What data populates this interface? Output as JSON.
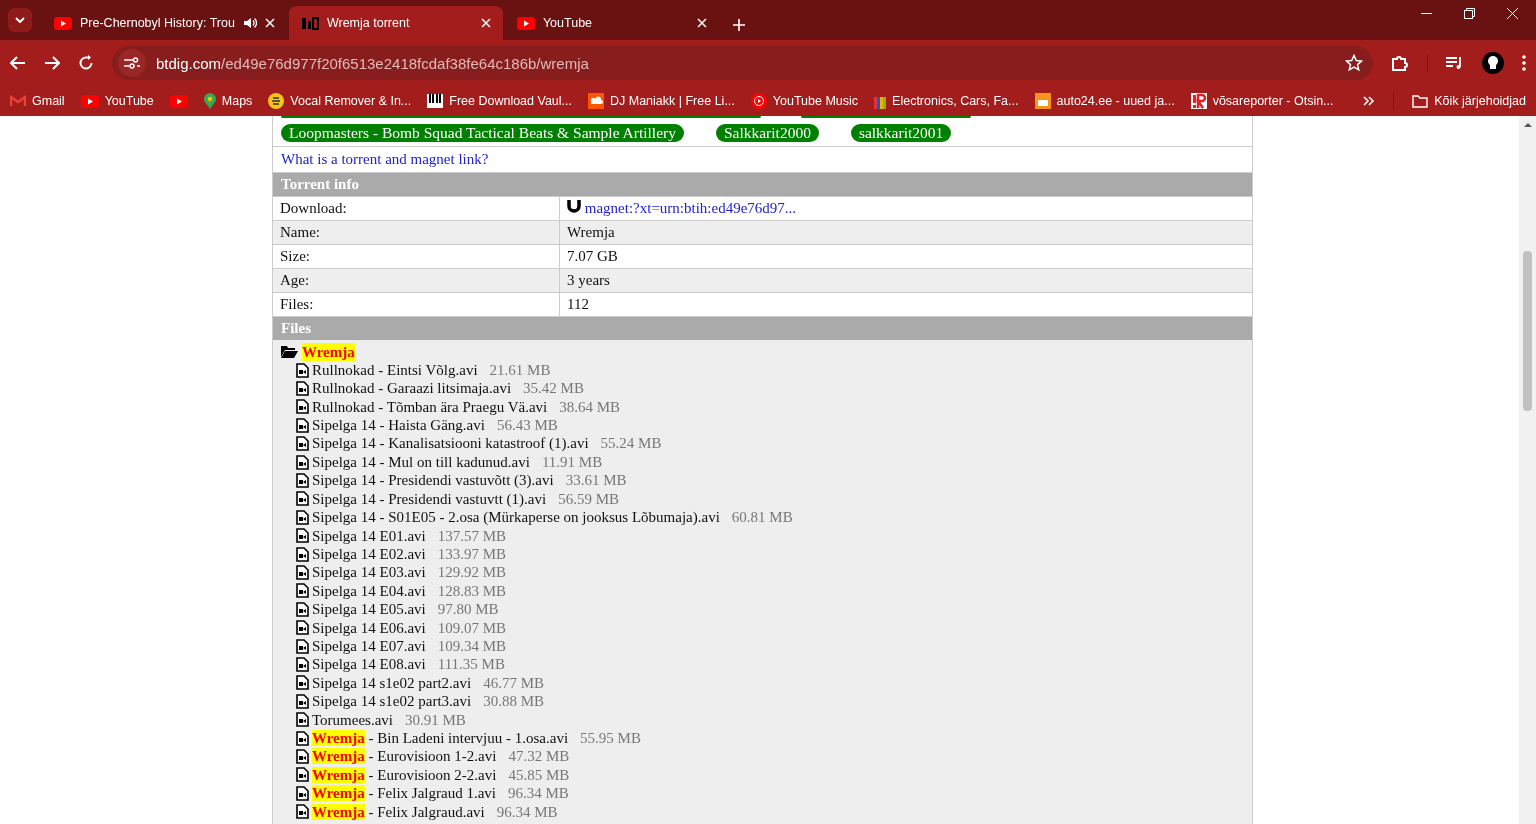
{
  "tabs": [
    {
      "title": "Pre-Chernobyl History: Trou",
      "audio": true,
      "selected": false
    },
    {
      "title": "Wremja torrent",
      "audio": false,
      "selected": true
    },
    {
      "title": "YouTube",
      "audio": false,
      "selected": false
    }
  ],
  "address": {
    "host": "btdig.com",
    "path": "/ed49e76d977f20f6513e2418fcdaf38fe64c186b/wremja"
  },
  "bookmarks": [
    {
      "kind": "link",
      "label": "Gmail"
    },
    {
      "kind": "link",
      "label": "YouTube"
    },
    {
      "kind": "icon"
    },
    {
      "kind": "link",
      "label": "Maps"
    },
    {
      "kind": "link",
      "label": "Vocal Remover & In..."
    },
    {
      "kind": "link",
      "label": "Free Download Vaul..."
    },
    {
      "kind": "link",
      "label": "DJ Maniakk | Free Li..."
    },
    {
      "kind": "link",
      "label": "YouTube Music"
    },
    {
      "kind": "link",
      "label": "Electronics, Cars, Fa..."
    },
    {
      "kind": "link",
      "label": "auto24.ee - uued ja..."
    },
    {
      "kind": "link",
      "label": "võsareporter - Otsin..."
    }
  ],
  "all_bookmarks": "Kõik järjehoidjad",
  "tags": [
    "Loopmasters - Bomb Squad Tactical Beats & Sample Artillery",
    "Salkkarit2000",
    "salkkarit2001"
  ],
  "help_link": "What is a torrent and magnet link?",
  "torrent_info": {
    "heading": "Torrent info",
    "rows": [
      {
        "label": "Download:",
        "value": "magnet:?xt=urn:btih:ed49e76d97...",
        "kind": "link"
      },
      {
        "label": "Name:",
        "value": "Wremja",
        "kind": "text"
      },
      {
        "label": "Size:",
        "value": "7.07 GB",
        "kind": "text"
      },
      {
        "label": "Age:",
        "value": "3 years",
        "kind": "text"
      },
      {
        "label": "Files:",
        "value": "112",
        "kind": "text"
      }
    ]
  },
  "files": {
    "heading": "Files",
    "folder": "Wremja",
    "items": [
      {
        "name": "Rullnokad - Eintsi Võlg.avi",
        "size": "21.61 MB"
      },
      {
        "name": "Rullnokad - Garaazi litsimaja.avi",
        "size": "35.42 MB"
      },
      {
        "name": "Rullnokad - Tõmban ära Praegu Vä.avi",
        "size": "38.64 MB"
      },
      {
        "name": "Sipelga 14 - Haista Gäng.avi",
        "size": "56.43 MB"
      },
      {
        "name": "Sipelga 14 - Kanalisatsiooni katastroof (1).avi",
        "size": "55.24 MB"
      },
      {
        "name": "Sipelga 14 - Mul on till kadunud.avi",
        "size": "11.91 MB"
      },
      {
        "name": "Sipelga 14 - Presidendi vastuvõtt (3).avi",
        "size": "33.61 MB"
      },
      {
        "name": "Sipelga 14 - Presidendi vastuvtt (1).avi",
        "size": "56.59 MB"
      },
      {
        "name": "Sipelga 14 - S01E05 - 2.osa (Mürkaperse on jooksus Lõbumaja).avi",
        "size": "60.81 MB"
      },
      {
        "name": "Sipelga 14 E01.avi",
        "size": "137.57 MB"
      },
      {
        "name": "Sipelga 14 E02.avi",
        "size": "133.97 MB"
      },
      {
        "name": "Sipelga 14 E03.avi",
        "size": "129.92 MB"
      },
      {
        "name": "Sipelga 14 E04.avi",
        "size": "128.83 MB"
      },
      {
        "name": "Sipelga 14 E05.avi",
        "size": "97.80 MB"
      },
      {
        "name": "Sipelga 14 E06.avi",
        "size": "109.07 MB"
      },
      {
        "name": "Sipelga 14 E07.avi",
        "size": "109.34 MB"
      },
      {
        "name": "Sipelga 14 E08.avi",
        "size": "111.35 MB"
      },
      {
        "name": "Sipelga 14 s1e02 part2.avi",
        "size": "46.77 MB"
      },
      {
        "name": "Sipelga 14 s1e02 part3.avi",
        "size": "30.88 MB"
      },
      {
        "name": "Torumees.avi",
        "size": "30.91 MB"
      },
      {
        "highlight": "Wremja",
        "name": " - Bin Ladeni intervjuu - 1.osa.avi",
        "size": "55.95 MB"
      },
      {
        "highlight": "Wremja",
        "name": " - Eurovisioon 1-2.avi",
        "size": "47.32 MB"
      },
      {
        "highlight": "Wremja",
        "name": " - Eurovisioon 2-2.avi",
        "size": "45.85 MB"
      },
      {
        "highlight": "Wremja",
        "name": " - Felix Jalgraud 1.avi",
        "size": "96.34 MB"
      },
      {
        "highlight": "Wremja",
        "name": " - Felix Jalgraud.avi",
        "size": "96.34 MB"
      }
    ]
  }
}
